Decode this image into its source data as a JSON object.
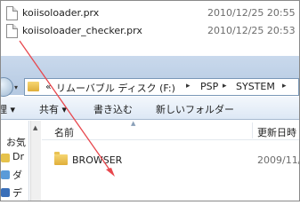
{
  "top_files": [
    {
      "name": "koiisoloader.prx",
      "date": "2010/12/25 20:55"
    },
    {
      "name": "koiisoloader_checker.prx",
      "date": "2010/12/25 20:53"
    }
  ],
  "address_bar": {
    "overflow": "«",
    "crumbs": [
      "リムーバブル ディスク (F:)",
      "PSP",
      "SYSTEM"
    ],
    "separator": "▸"
  },
  "toolbar": {
    "left_partial": "理 ▾",
    "share": "共有 ▾",
    "burn": "書き込む",
    "new_folder": "新しいフォルダー"
  },
  "nav_pane": {
    "items": [
      "お気",
      "Dr",
      "ダ",
      "デ"
    ]
  },
  "columns": {
    "name": "名前",
    "date": "更新日時"
  },
  "folders": [
    {
      "name": "BROWSER",
      "date": "2009/11/"
    }
  ],
  "colors": {
    "annotation_arrow": "#e8474d",
    "folder": "#e6bb45"
  }
}
